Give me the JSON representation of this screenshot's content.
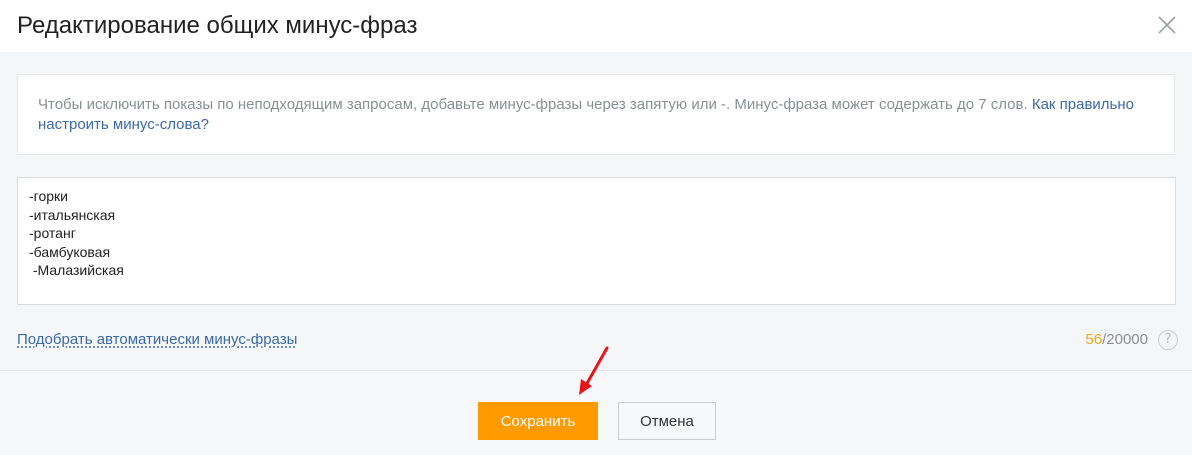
{
  "dialog": {
    "title": "Редактирование общих минус-фраз",
    "close_icon": "close-icon"
  },
  "hint": {
    "text": "Чтобы исключить показы по неподходящим запросам, добавьте минус-фразы через запятую или -. Минус-фраза может содержать до 7 слов. ",
    "link_text": "Как правильно настроить минус-слова?"
  },
  "editor": {
    "value": "-горки\n-итальянская\n-ротанг\n-бамбуковая\n -Малазийская"
  },
  "footer_controls": {
    "auto_pick_link": "Подобрать автоматически минус-фразы",
    "counter_current": "56",
    "counter_max": "/20000",
    "help_icon": "question-icon",
    "help_symbol": "?"
  },
  "buttons": {
    "save_label": "Сохранить",
    "cancel_label": "Отмена"
  },
  "colors": {
    "accent": "#ff9a00",
    "link": "#3a6aa8",
    "counter_highlight": "#f5a623",
    "annotation_arrow": "#e8141a"
  }
}
